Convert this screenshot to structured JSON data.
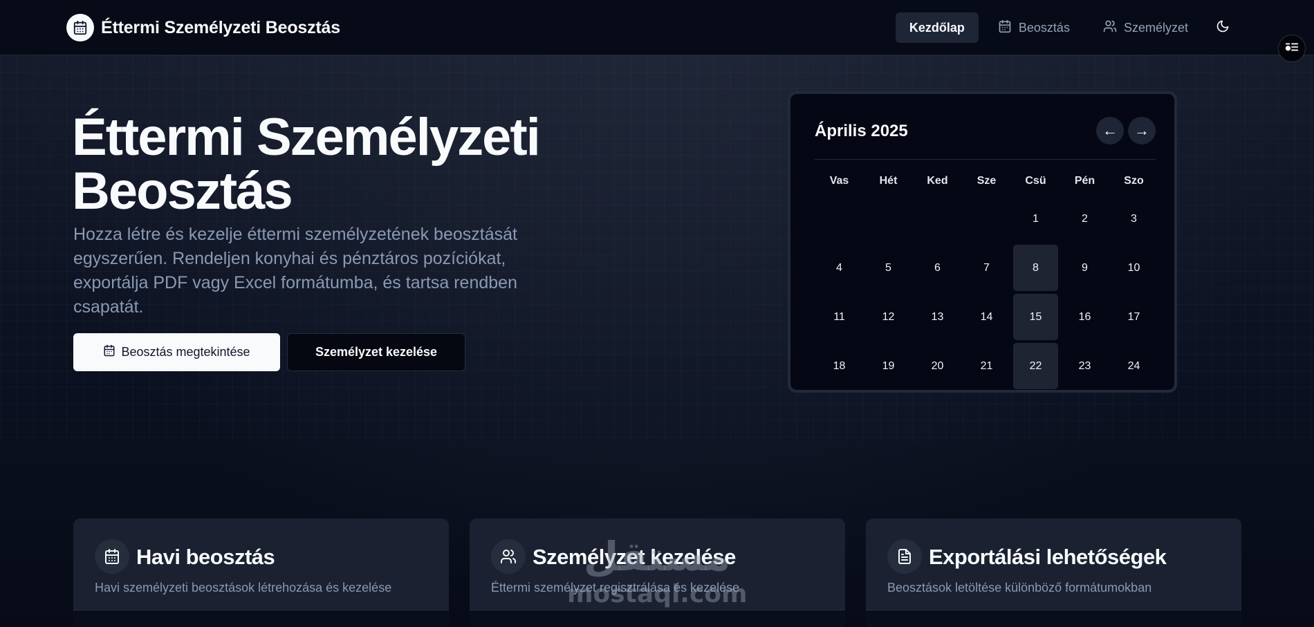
{
  "header": {
    "brand_title": "Éttermi Személyzeti Beosztás",
    "nav": [
      {
        "label": "Kezdőlap",
        "icon": "none",
        "active": true
      },
      {
        "label": "Beosztás",
        "icon": "calendar-icon",
        "active": false
      },
      {
        "label": "Személyzet",
        "icon": "users-icon",
        "active": false
      }
    ],
    "theme_icon": "moon-icon"
  },
  "hero": {
    "title": "Éttermi Személyzeti Beosztás",
    "description": "Hozza létre és kezelje éttermi személyzetének beosztását egyszerűen. Rendeljen konyhai és pénztáros pozíciókat, exportálja PDF vagy Excel formátumba, és tartsa rendben csapatát.",
    "primary_button": "Beosztás megtekintése",
    "secondary_button": "Személyzet kezelése"
  },
  "calendar": {
    "month_label": "Április 2025",
    "prev_label": "←",
    "next_label": "→",
    "weekdays": [
      "Vas",
      "Hét",
      "Ked",
      "Sze",
      "Csü",
      "Pén",
      "Szo"
    ],
    "weeks": [
      [
        "",
        "",
        "",
        "",
        "1",
        "2",
        "3"
      ],
      [
        "4",
        "5",
        "6",
        "7",
        "8",
        "9",
        "10"
      ],
      [
        "11",
        "12",
        "13",
        "14",
        "15",
        "16",
        "17"
      ],
      [
        "18",
        "19",
        "20",
        "21",
        "22",
        "23",
        "24"
      ]
    ],
    "highlighted_days": [
      "8",
      "15",
      "22"
    ]
  },
  "cards": [
    {
      "icon": "calendar-icon",
      "title": "Havi beosztás",
      "description": "Havi személyzeti beosztások létrehozása és kezelése"
    },
    {
      "icon": "users-icon",
      "title": "Személyzet kezelése",
      "description": "Éttermi személyzet regisztrálása és kezelése"
    },
    {
      "icon": "file-text-icon",
      "title": "Exportálási lehetőségek",
      "description": "Beosztások letöltése különböző formátumokban"
    }
  ],
  "watermark": {
    "arabic": "مستقل",
    "latin": "mostaql.com"
  },
  "colors": {
    "background": "#070b17",
    "card": "#1b2130",
    "muted_text": "#8a99b4",
    "primary_button": "#f8fafc"
  }
}
